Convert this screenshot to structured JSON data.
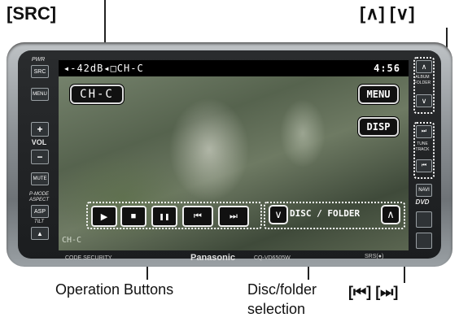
{
  "callouts": {
    "src": "[SRC]",
    "album_folder": "[∧] [∨]",
    "operation_buttons": "Operation Buttons",
    "disc_folder_line1": "Disc/folder",
    "disc_folder_line2": "selection",
    "track": "[⏮] [⏭]"
  },
  "status": {
    "left": "◂-42dB◂□CH-C",
    "time": "4:56"
  },
  "screen": {
    "channel_button": "CH-C",
    "menu_button": "MENU",
    "disp_button": "DISP",
    "disc_folder_label": "DISC / FOLDER",
    "bottom_left": "CH-C"
  },
  "left_panel": {
    "pwr": "PWR",
    "src": "SRC",
    "menu": "MENU",
    "vol": "VOL",
    "mute": "MUTE",
    "pmode": "P-MODE",
    "aspect": "ASPECT",
    "asp": "ASP",
    "tilt": "TILT"
  },
  "right_panel": {
    "album_folder": "ALBUM FOLDER",
    "tune_track": "TUNE TRACK",
    "navi": "NAVI",
    "dvd": "DVD"
  },
  "bottom_bar": {
    "code_security": "CODE SECURITY",
    "brand": "Panasonic",
    "model": "CQ-VD6505W",
    "srs": "SRS(●)"
  },
  "icons": {
    "play": "▶",
    "stop": "■",
    "pause": "❚❚",
    "prev": "⏮",
    "next": "⏭",
    "down": "∨",
    "up": "∧",
    "plus": "+",
    "minus": "−"
  }
}
